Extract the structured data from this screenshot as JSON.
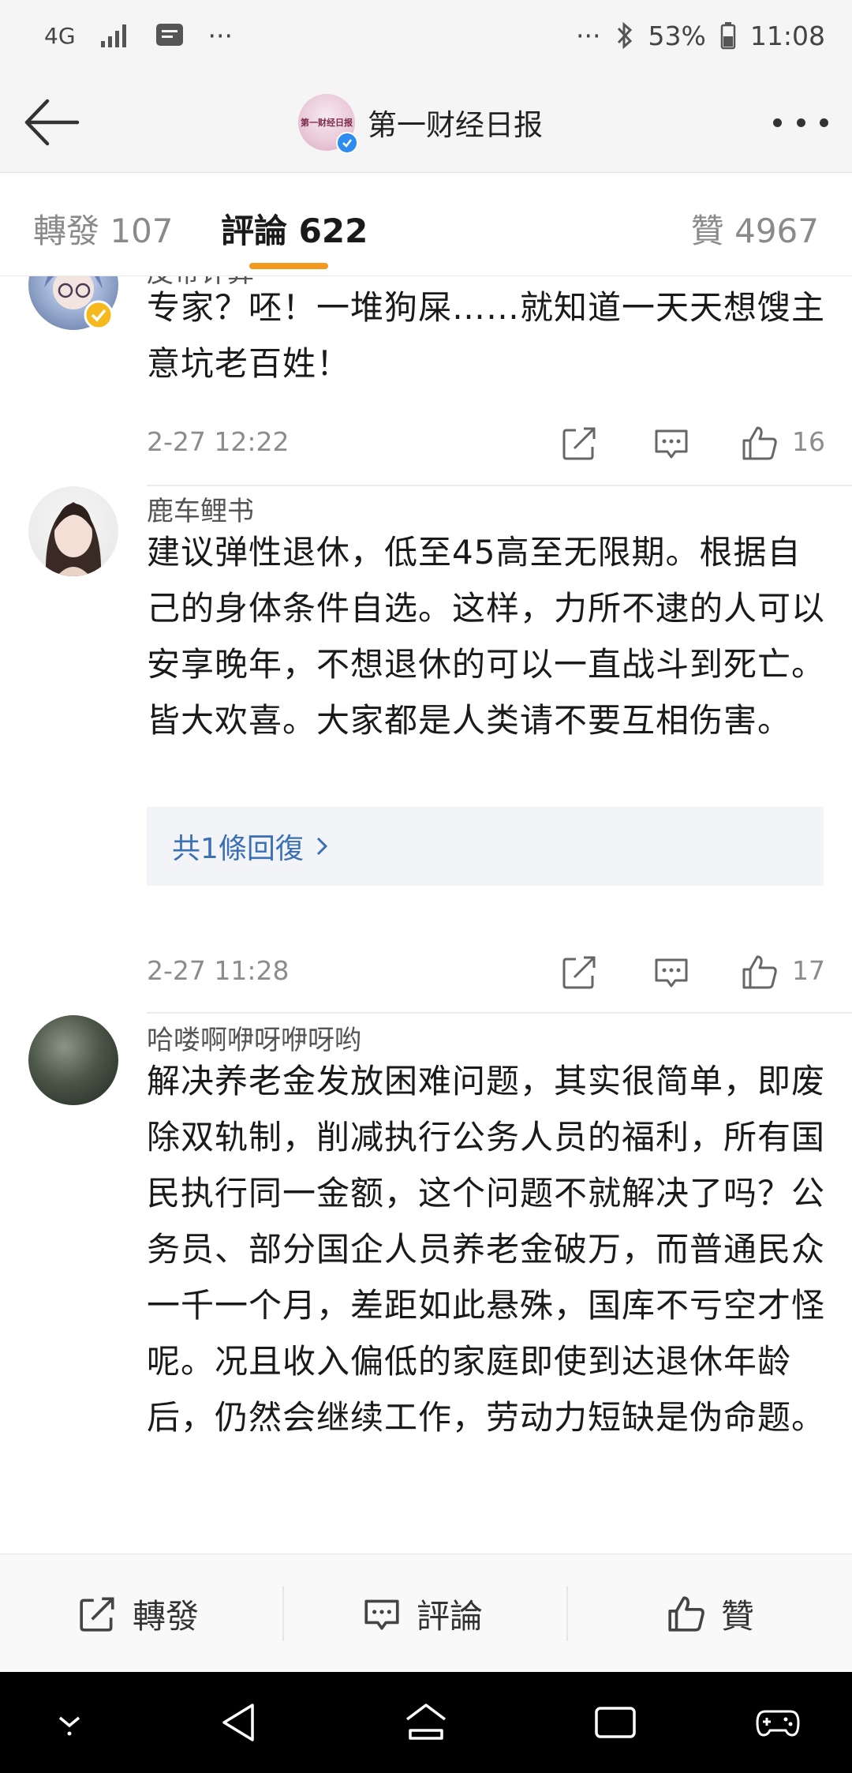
{
  "status_bar": {
    "network": "4G",
    "more": "···",
    "more_right": "···",
    "battery": "53%",
    "time": "11:08"
  },
  "header": {
    "title": "第一财经日报",
    "logo_text": "第一财经日报"
  },
  "tabs": [
    {
      "label": "轉發 107"
    },
    {
      "label": "評論 622"
    },
    {
      "label": "贊 4967"
    }
  ],
  "comments": [
    {
      "username": "皮帯计算",
      "text": "专家？呸！一堆狗屎……就知道一天天想馊主意坑老百姓！",
      "timestamp": "2-27 12:22",
      "likes": "16"
    },
    {
      "username": "鹿车鲤书",
      "text": "建议弹性退休，低至45高至无限期。根据自己的身体条件自选。这样，力所不逮的人可以安享晚年，不想退休的可以一直战斗到死亡。皆大欢喜。大家都是人类请不要互相伤害。",
      "reply_label": "共1條回復",
      "timestamp": "2-27 11:28",
      "likes": "17"
    },
    {
      "username": "哈喽啊咿呀咿呀哟",
      "text": "解决养老金发放困难问题，其实很简单，即废除双轨制，削减执行公务人员的福利，所有国民执行同一金额，这个问题不就解决了吗？公务员、部分国企人员养老金破万，而普通民众一千一个月，差距如此悬殊，国库不亏空才怪呢。况且收入偏低的家庭即使到达退休年龄后，仍然会继续工作，劳动力短缺是伪命题。"
    }
  ],
  "bottom_bar": {
    "repost": "轉發",
    "comment": "評論",
    "like": "贊"
  },
  "colors": {
    "accent": "#f39a1e",
    "link": "#3b6fb6",
    "verified": "#f5b91e"
  }
}
